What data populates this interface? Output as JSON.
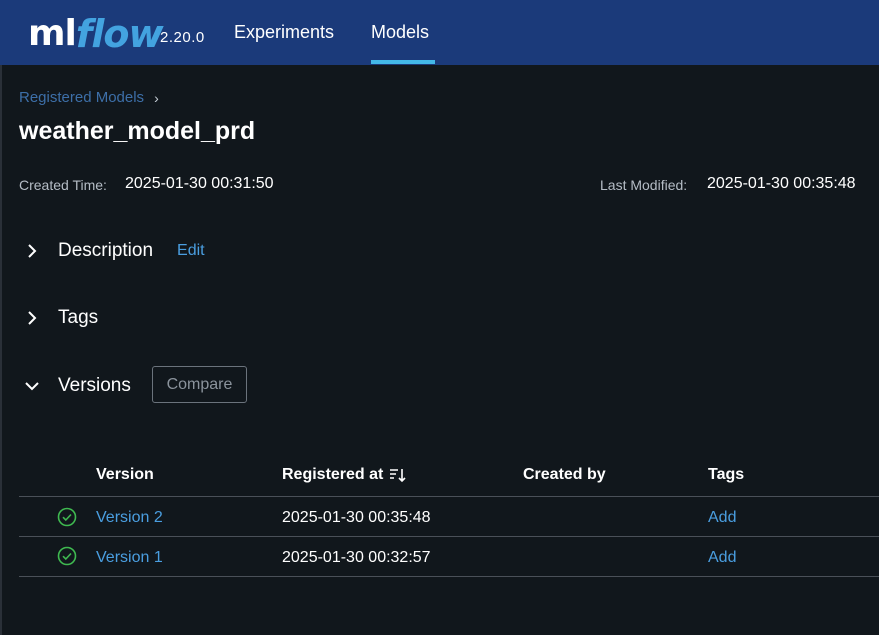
{
  "header": {
    "logo_ml": "ml",
    "logo_flow": "flow",
    "version": "2.20.0",
    "nav": [
      {
        "label": "Experiments",
        "active": false
      },
      {
        "label": "Models",
        "active": true
      }
    ],
    "colors": {
      "background": "#1b3a7a",
      "accent": "#43b8e8",
      "logo_flow": "#43a3e0"
    }
  },
  "breadcrumb": {
    "label": "Registered Models",
    "separator": "›"
  },
  "model": {
    "name": "weather_model_prd",
    "created_label": "Created Time:",
    "created_value": "2025-01-30 00:31:50",
    "modified_label": "Last Modified:",
    "modified_value": "2025-01-30 00:35:48"
  },
  "sections": {
    "description": {
      "title": "Description",
      "edit_label": "Edit",
      "expanded": false
    },
    "tags": {
      "title": "Tags",
      "expanded": false
    },
    "versions": {
      "title": "Versions",
      "compare_label": "Compare",
      "expanded": true
    }
  },
  "table": {
    "columns": [
      "Version",
      "Registered at",
      "Created by",
      "Tags"
    ],
    "sort_icon": "sort-descending-icon",
    "rows": [
      {
        "status_icon": "check-circle-icon",
        "version": "Version 2",
        "registered_at": "2025-01-30 00:35:48",
        "created_by": "",
        "tags": "Add"
      },
      {
        "status_icon": "check-circle-icon",
        "version": "Version 1",
        "registered_at": "2025-01-30 00:32:57",
        "created_by": "",
        "tags": "Add"
      }
    ]
  },
  "colors": {
    "link": "#4a9ee0",
    "status_ok": "#3fb950",
    "page_bg": "#11171c"
  }
}
